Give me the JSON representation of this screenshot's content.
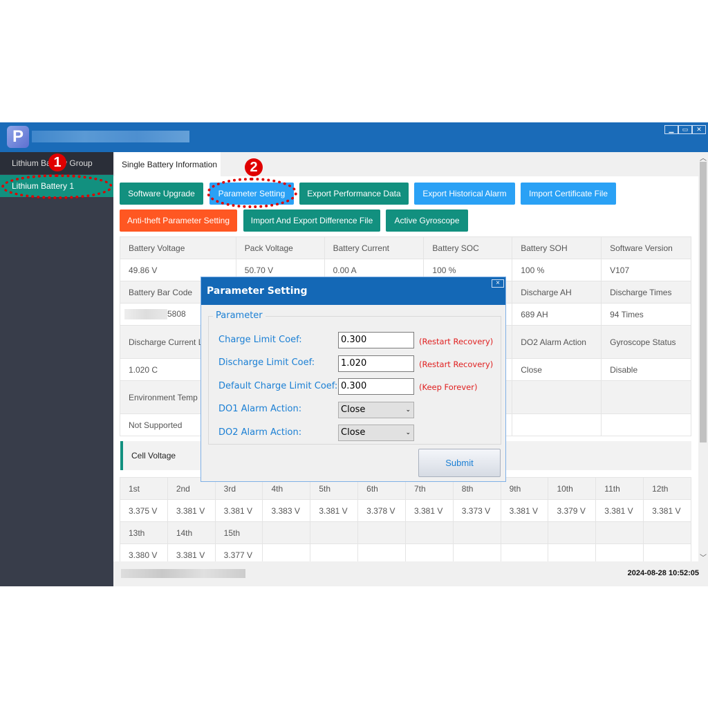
{
  "window": {
    "controls": [
      "minimize",
      "maximize",
      "close"
    ]
  },
  "sidebar": {
    "items": [
      {
        "label": "Lithium Battery Group"
      },
      {
        "label": "Lithium Battery 1",
        "active": true
      }
    ]
  },
  "tab": {
    "label": "Single Battery Information"
  },
  "buttons": [
    {
      "label": "Software Upgrade",
      "color": "#12907f"
    },
    {
      "label": "Parameter Setting",
      "color": "#2aa1f5"
    },
    {
      "label": "Export Performance Data",
      "color": "#12907f"
    },
    {
      "label": "Export Historical Alarm",
      "color": "#2aa1f5"
    },
    {
      "label": "Import Certificate File",
      "color": "#2aa1f5"
    },
    {
      "label": "Anti-theft Parameter Setting",
      "color": "#ff5722"
    },
    {
      "label": "Import And Export Difference File",
      "color": "#12907f"
    },
    {
      "label": "Active Gyroscope",
      "color": "#12907f"
    }
  ],
  "info": {
    "r1h": [
      "Battery Voltage",
      "Pack Voltage",
      "Battery Current",
      "Battery SOC",
      "Battery SOH",
      "Software Version"
    ],
    "r1v": [
      "49.86 V",
      "50.70 V",
      "0.00 A",
      "100 %",
      "100 %",
      "V107"
    ],
    "r2h": [
      "Battery Bar Code",
      "",
      "",
      "",
      "Discharge AH",
      "Discharge Times"
    ],
    "r2v": [
      "5808",
      "",
      "",
      "",
      "689 AH",
      "94 Times"
    ],
    "r3h": [
      "Discharge Current Li",
      "",
      "",
      "",
      "DO2 Alarm Action",
      "Gyroscope Status"
    ],
    "r3v": [
      "1.020 C",
      "",
      "",
      "",
      "Close",
      "Disable"
    ],
    "r4h": [
      "Environment Temp",
      "",
      "",
      "",
      "",
      ""
    ],
    "r4v": [
      "Not Supported",
      "",
      "",
      "",
      "",
      ""
    ]
  },
  "cell_voltage": {
    "title": "Cell Voltage",
    "labels1": [
      "1st",
      "2nd",
      "3rd",
      "4th",
      "5th",
      "6th",
      "7th",
      "8th",
      "9th",
      "10th",
      "11th",
      "12th"
    ],
    "values1": [
      "3.375 V",
      "3.381 V",
      "3.381 V",
      "3.383 V",
      "3.381 V",
      "3.378 V",
      "3.381 V",
      "3.373 V",
      "3.381 V",
      "3.379 V",
      "3.381 V",
      "3.381 V"
    ],
    "labels2": [
      "13th",
      "14th",
      "15th",
      "",
      "",
      "",
      "",
      "",
      "",
      "",
      "",
      ""
    ],
    "values2": [
      "3.380 V",
      "3.381 V",
      "3.377 V",
      "",
      "",
      "",
      "",
      "",
      "",
      "",
      "",
      ""
    ]
  },
  "status": {
    "datetime": "2024-08-28 10:52:05"
  },
  "dialog": {
    "title": "Parameter Setting",
    "close": "×",
    "group": "Parameter",
    "fields": [
      {
        "label": "Charge Limit Coef:",
        "value": "0.300",
        "note": "(Restart Recovery)"
      },
      {
        "label": "Discharge Limit Coef:",
        "value": "1.020",
        "note": "(Restart Recovery)"
      },
      {
        "label": "Default Charge Limit Coef:",
        "value": "0.300",
        "note": "(Keep Forever)"
      },
      {
        "label": "DO1 Alarm Action:",
        "value": "Close",
        "note": ""
      },
      {
        "label": "DO2 Alarm Action:",
        "value": "Close",
        "note": ""
      }
    ],
    "submit": "Submit"
  },
  "annotations": {
    "n1": "1",
    "n2": "2"
  }
}
